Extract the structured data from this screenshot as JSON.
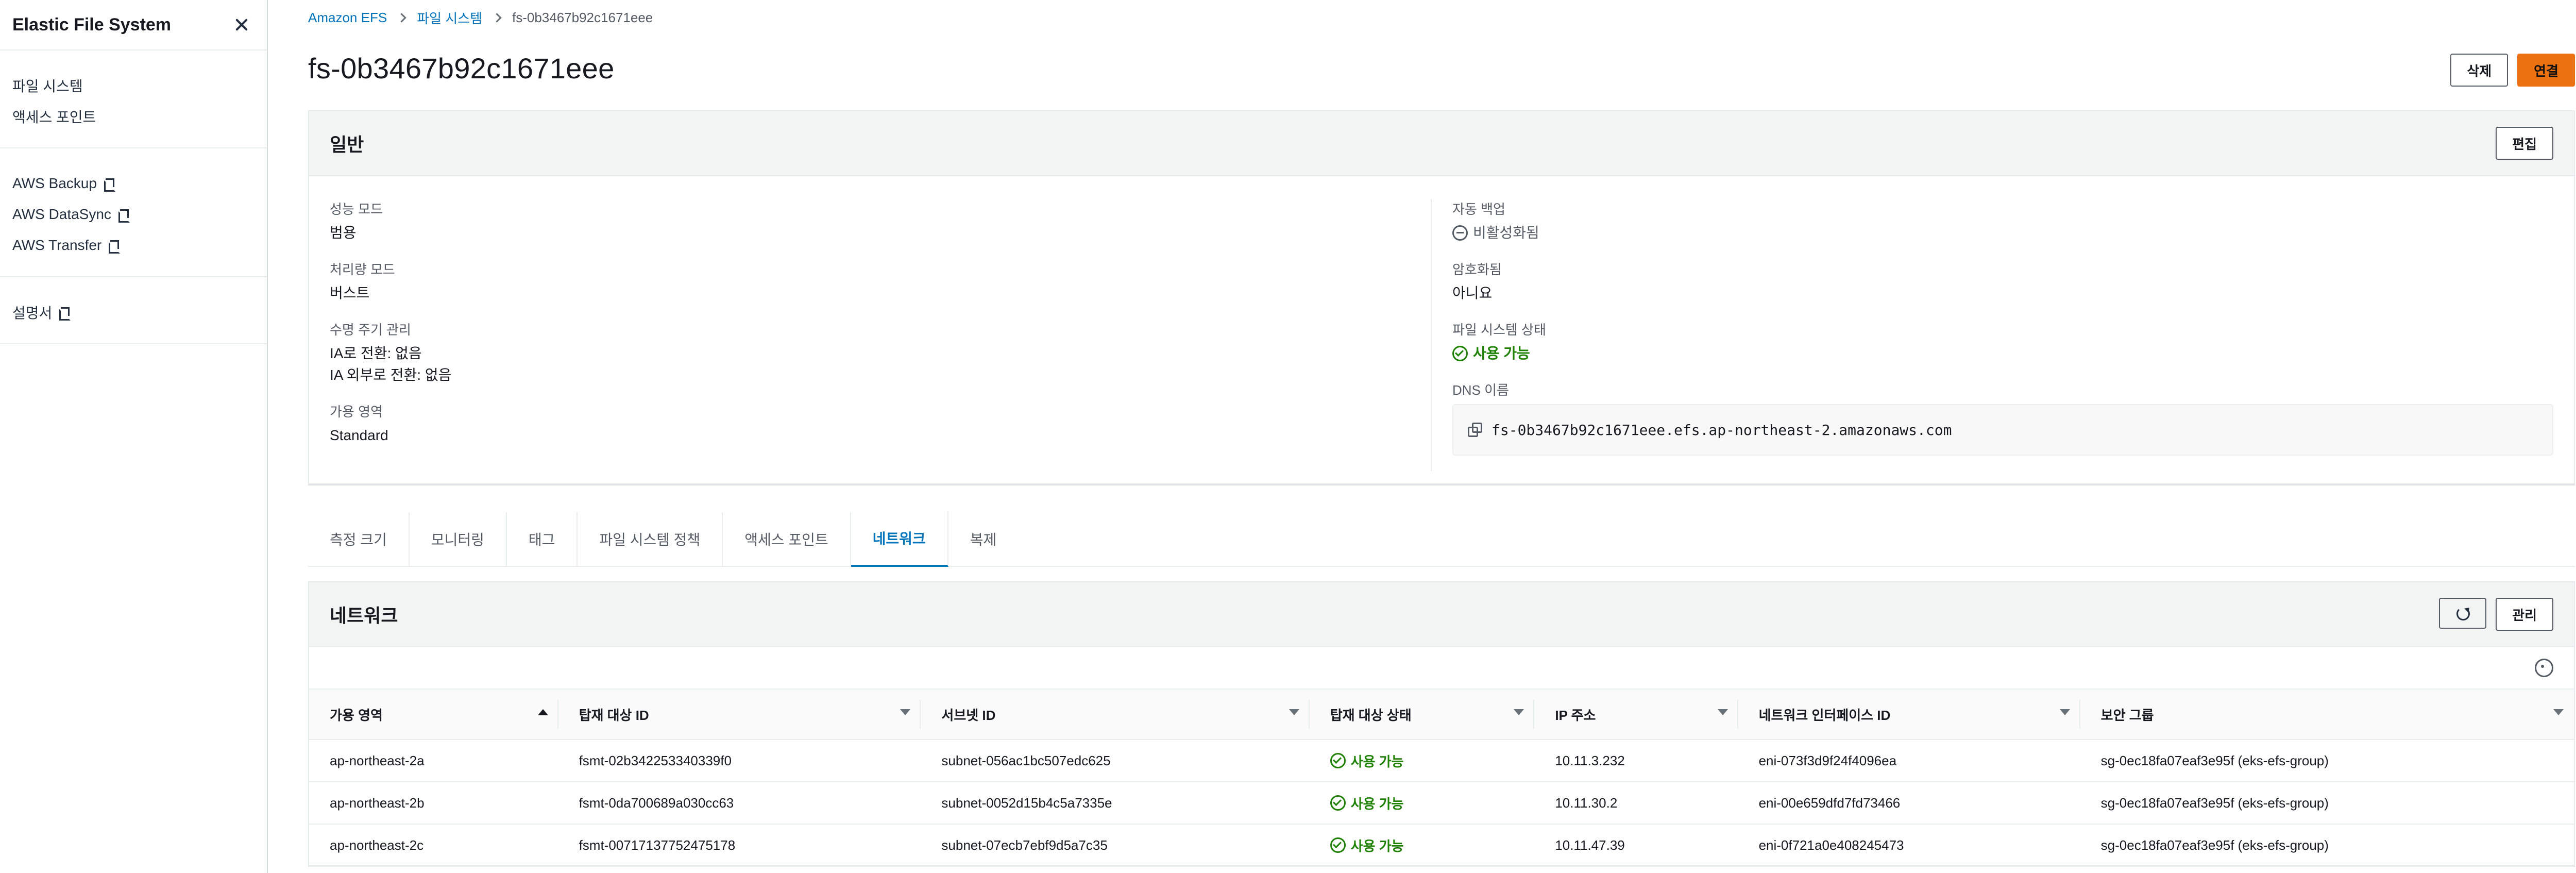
{
  "sidebar": {
    "title": "Elastic File System",
    "items_main": [
      "파일 시스템",
      "액세스 포인트"
    ],
    "items_services": [
      "AWS Backup",
      "AWS DataSync",
      "AWS Transfer"
    ],
    "items_docs": [
      "설명서"
    ]
  },
  "breadcrumb": {
    "root": "Amazon EFS",
    "level2": "파일 시스템",
    "current": "fs-0b3467b92c1671eee"
  },
  "page": {
    "title": "fs-0b3467b92c1671eee",
    "actions": {
      "delete": "삭제",
      "connect": "연결"
    }
  },
  "general": {
    "title": "일반",
    "edit": "편집",
    "left": [
      {
        "label": "성능 모드",
        "value": "범용"
      },
      {
        "label": "처리량 모드",
        "value": "버스트"
      },
      {
        "label": "수명 주기 관리",
        "value_lines": [
          "IA로 전환: 없음",
          "IA 외부로 전환: 없음"
        ]
      },
      {
        "label": "가용 영역",
        "value": "Standard"
      }
    ],
    "right": [
      {
        "label": "자동 백업",
        "value": "비활성화됨",
        "status": "disabled"
      },
      {
        "label": "암호화됨",
        "value": "아니요"
      },
      {
        "label": "파일 시스템 상태",
        "value": "사용 가능",
        "status": "available"
      },
      {
        "label": "DNS 이름",
        "value": "fs-0b3467b92c1671eee.efs.ap-northeast-2.amazonaws.com"
      }
    ]
  },
  "tabs": [
    "측정 크기",
    "모니터링",
    "태그",
    "파일 시스템 정책",
    "액세스 포인트",
    "네트워크",
    "복제"
  ],
  "active_tab": "네트워크",
  "network": {
    "title": "네트워크",
    "manage": "관리",
    "columns": [
      "가용 영역",
      "탑재 대상 ID",
      "서브넷 ID",
      "탑재 대상 상태",
      "IP 주소",
      "네트워크 인터페이스 ID",
      "보안 그룹"
    ],
    "rows": [
      [
        "ap-northeast-2a",
        "fsmt-02b342253340339f0",
        "subnet-056ac1bc507edc625",
        "사용 가능",
        "10.11.3.232",
        "eni-073f3d9f24f4096ea",
        "sg-0ec18fa07eaf3e95f (eks-efs-group)"
      ],
      [
        "ap-northeast-2b",
        "fsmt-0da700689a030cc63",
        "subnet-0052d15b4c5a7335e",
        "사용 가능",
        "10.11.30.2",
        "eni-00e659dfd7fd73466",
        "sg-0ec18fa07eaf3e95f (eks-efs-group)"
      ],
      [
        "ap-northeast-2c",
        "fsmt-00717137752475178",
        "subnet-07ecb7ebf9d5a7c35",
        "사용 가능",
        "10.11.47.39",
        "eni-0f721a0e408245473",
        "sg-0ec18fa07eaf3e95f (eks-efs-group)"
      ]
    ]
  },
  "colors": {
    "link": "#0073bb",
    "orange": "#ec7211",
    "success": "#1d8102"
  }
}
